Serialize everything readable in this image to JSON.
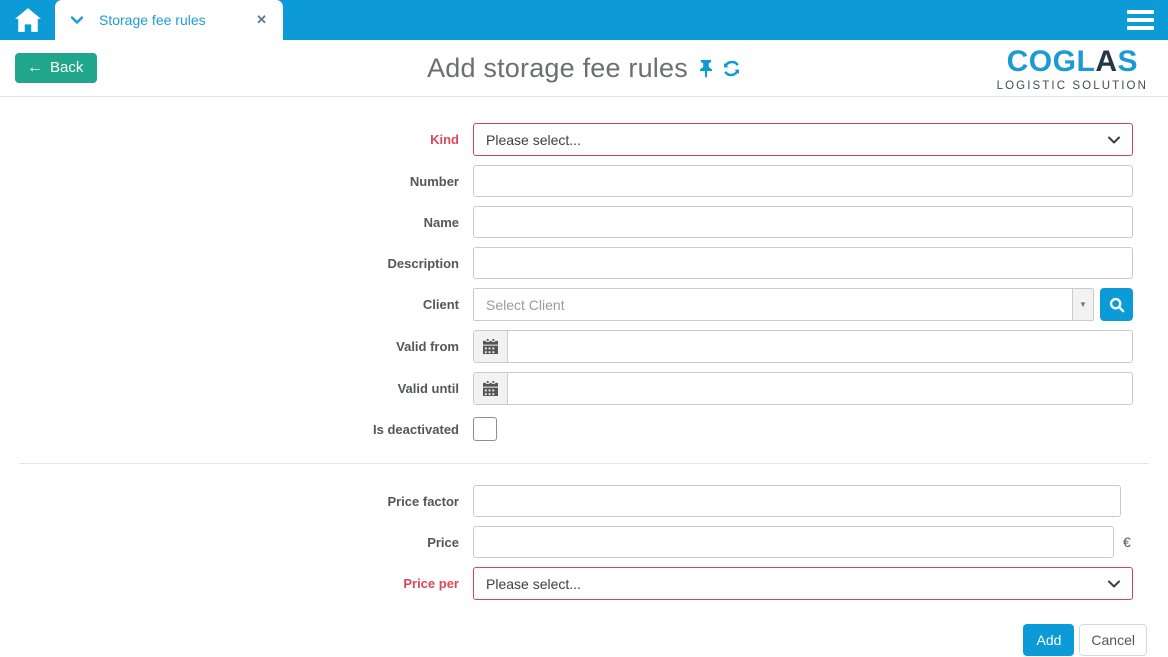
{
  "topbar": {
    "tab": {
      "label": "Storage fee rules"
    }
  },
  "header": {
    "back_label": "Back",
    "title": "Add storage fee rules",
    "logo": {
      "brand_part1": "COGL",
      "brand_part2": "A",
      "brand_part3": "S",
      "tagline": "LOGISTIC SOLUTION"
    }
  },
  "form": {
    "kind": {
      "label": "Kind",
      "value": "Please select..."
    },
    "number": {
      "label": "Number",
      "value": ""
    },
    "name": {
      "label": "Name",
      "value": ""
    },
    "description": {
      "label": "Description",
      "value": ""
    },
    "client": {
      "label": "Client",
      "placeholder": "Select Client",
      "value": ""
    },
    "valid_from": {
      "label": "Valid from",
      "value": ""
    },
    "valid_until": {
      "label": "Valid until",
      "value": ""
    },
    "is_deactivated": {
      "label": "Is deactivated",
      "checked": false
    },
    "price_factor": {
      "label": "Price factor",
      "value": ""
    },
    "price": {
      "label": "Price",
      "value": "",
      "currency": "€"
    },
    "price_per": {
      "label": "Price per",
      "value": "Please select..."
    }
  },
  "actions": {
    "add": "Add",
    "cancel": "Cancel"
  },
  "colors": {
    "accent_cyan": "#0C9BD7",
    "back_green": "#1FA68B",
    "required_red": "#DC4857",
    "title_gray": "#6D6E71"
  }
}
